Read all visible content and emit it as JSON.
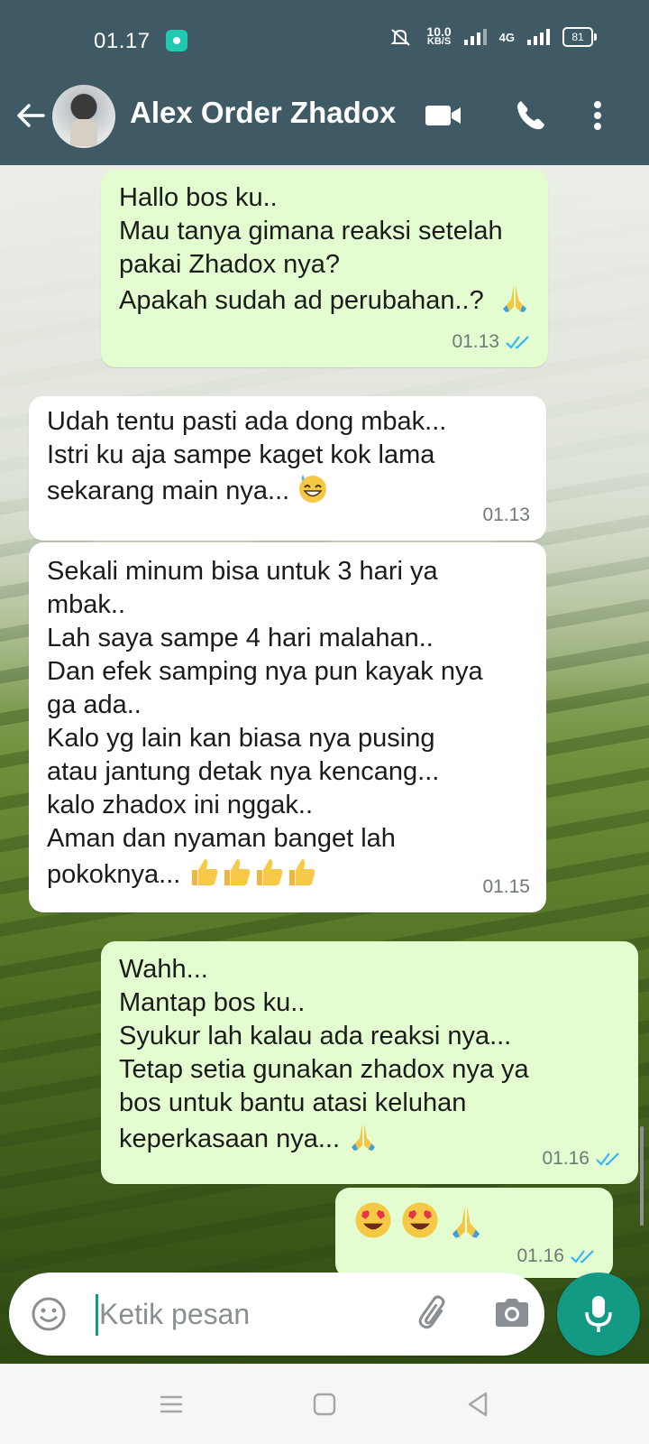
{
  "status_bar": {
    "time": "01.17",
    "speed_value": "10.0",
    "speed_unit": "KB/S",
    "network": "4G",
    "battery": "81"
  },
  "header": {
    "contact_name": "Alex Order Zhadox",
    "icons": [
      "back-arrow-icon",
      "video-call-icon",
      "voice-call-icon",
      "more-options-icon"
    ]
  },
  "messages": [
    {
      "direction": "out",
      "text": "Hallo bos ku..\nMau tanya gimana reaksi setelah\npakai Zhadox nya?\nApakah sudah ad perubahan..?",
      "emoji": [
        "folded-hands"
      ],
      "time": "01.13",
      "status": "read"
    },
    {
      "direction": "in",
      "text": "Udah tentu pasti ada dong mbak...\nIstri ku aja sampe kaget kok lama\nsekarang main nya...",
      "emoji": [
        "grinning-sweat"
      ],
      "time": "01.13"
    },
    {
      "direction": "in",
      "text": "Sekali minum bisa untuk 3 hari ya\nmbak..\nLah saya sampe 4 hari malahan..\nDan efek samping nya pun kayak nya\nga ada..\nKalo yg lain kan biasa nya pusing\natau jantung detak nya kencang...\nkalo zhadox ini nggak..\nAman dan nyaman banget lah\npokoknya...",
      "emoji": [
        "thumbs-up",
        "thumbs-up",
        "thumbs-up",
        "thumbs-up"
      ],
      "time": "01.15"
    },
    {
      "direction": "out",
      "text": "Wahh...\nMantap bos ku..\nSyukur lah kalau ada reaksi nya...\nTetap setia gunakan zhadox nya ya\nbos untuk bantu atasi keluhan\nkeperkasaan nya...",
      "emoji": [
        "folded-hands"
      ],
      "time": "01.16",
      "status": "read"
    },
    {
      "direction": "out",
      "text": "",
      "emoji": [
        "heart-eyes",
        "heart-eyes",
        "folded-hands"
      ],
      "time": "01.16",
      "status": "read"
    }
  ],
  "composer": {
    "placeholder": "Ketik pesan"
  },
  "colors": {
    "header_bg": "#3f5a64",
    "outgoing_bubble": "#e3fdd0",
    "incoming_bubble": "#ffffff",
    "accent": "#139a85",
    "read_tick": "#34b7f1"
  }
}
